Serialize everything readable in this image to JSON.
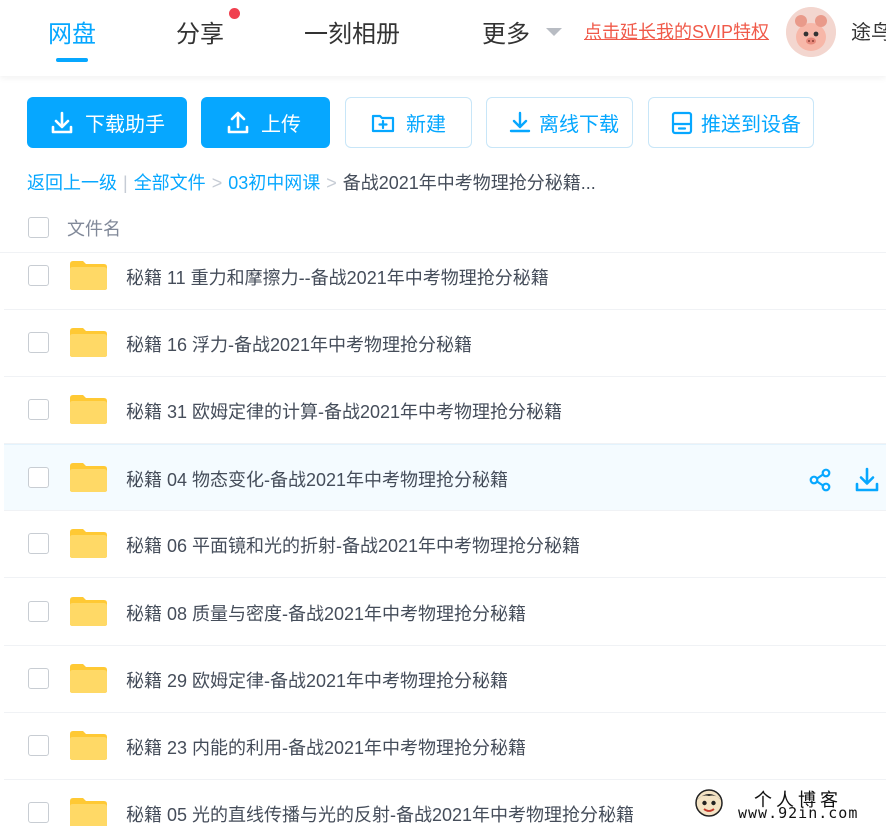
{
  "nav": {
    "items": [
      "网盘",
      "分享",
      "一刻相册",
      "更多"
    ],
    "svip_link": "点击延长我的SVIP特权",
    "username": "途鸟"
  },
  "toolbar": {
    "download_helper": "下载助手",
    "upload": "上传",
    "new": "新建",
    "offline_download": "离线下载",
    "push_to_device": "推送到设备"
  },
  "breadcrumb": {
    "back": "返回上一级",
    "all_files": "全部文件",
    "folder": "03初中网课",
    "current": "备战2021年中考物理抢分秘籍..."
  },
  "list": {
    "header": "文件名",
    "rows": [
      "秘籍 11 重力和摩擦力--备战2021年中考物理抢分秘籍",
      "秘籍 16 浮力-备战2021年中考物理抢分秘籍",
      "秘籍 31 欧姆定律的计算-备战2021年中考物理抢分秘籍",
      "秘籍 04 物态变化-备战2021年中考物理抢分秘籍",
      "秘籍 06 平面镜和光的折射-备战2021年中考物理抢分秘籍",
      "秘籍 08 质量与密度-备战2021年中考物理抢分秘籍",
      "秘籍 29 欧姆定律-备战2021年中考物理抢分秘籍",
      "秘籍 23 内能的利用-备战2021年中考物理抢分秘籍",
      "秘籍 05 光的直线传播与光的反射-备战2021年中考物理抢分秘籍"
    ],
    "hovered_index": 3
  },
  "watermark": {
    "line1": "个人博客",
    "line2": "www.92in.com"
  },
  "colors": {
    "accent": "#06a7ff",
    "folder": "#ffd34f",
    "svip": "#f05a4a",
    "badge": "#f0404f"
  },
  "icons": {
    "download": "download-icon",
    "upload": "upload-icon",
    "new_folder": "new-folder-icon",
    "offline": "offline-download-icon",
    "device": "device-icon",
    "share": "share-icon",
    "folder": "folder-icon"
  }
}
